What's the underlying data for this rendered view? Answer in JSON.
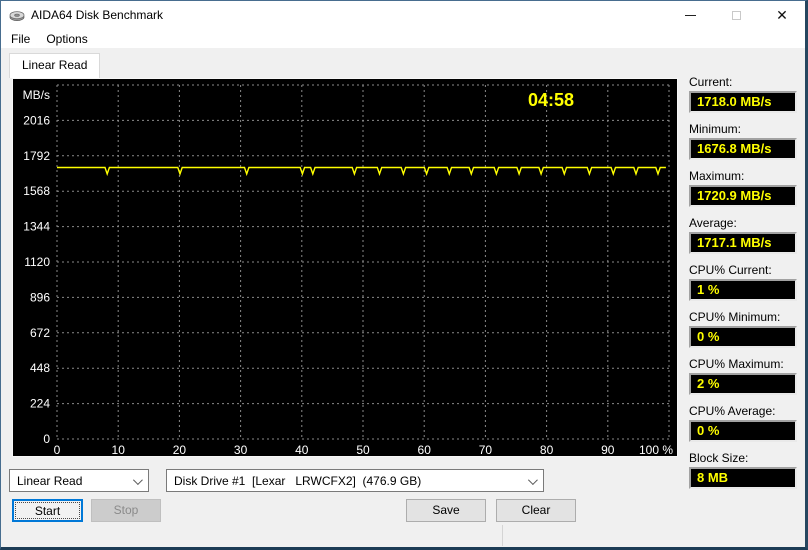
{
  "window": {
    "title": "AIDA64 Disk Benchmark"
  },
  "menu": {
    "items": [
      "File",
      "Options"
    ]
  },
  "tab": {
    "label": "Linear Read"
  },
  "chart_data": {
    "type": "line",
    "title": "",
    "time_label": "04:58",
    "ylabel": "MB/s",
    "xlabel": "",
    "ylim": [
      0,
      2240
    ],
    "yticks": [
      0,
      224,
      448,
      672,
      896,
      1120,
      1344,
      1568,
      1792,
      2016
    ],
    "xticks": [
      "0",
      "10",
      "20",
      "30",
      "40",
      "50",
      "60",
      "70",
      "80",
      "90",
      "100 %"
    ],
    "xlim_pct": [
      0,
      100
    ],
    "grid": true,
    "series": [
      {
        "name": "Linear Read MB/s",
        "baseline_value": 1718,
        "dip_value": 1677,
        "dip_positions_pct": [
          8.2,
          20.1,
          31.0,
          40.1,
          41.8,
          48.6,
          52.7,
          56.6,
          60.4,
          64.1,
          67.7,
          71.8,
          75.5,
          79.1,
          82.9,
          87.0,
          90.9,
          94.6,
          98.2
        ],
        "start_pct": 0,
        "end_pct": 99.5
      }
    ],
    "colors": {
      "background": "#000000",
      "grid": "#8a8a8a",
      "line": "#ffff00",
      "text": "#ffffff",
      "time": "#ffff00"
    }
  },
  "stats": [
    {
      "label": "Current:",
      "value": "1718.0 MB/s"
    },
    {
      "label": "Minimum:",
      "value": "1676.8 MB/s"
    },
    {
      "label": "Maximum:",
      "value": "1720.9 MB/s"
    },
    {
      "label": "Average:",
      "value": "1717.1 MB/s"
    },
    {
      "label": "CPU% Current:",
      "value": "1 %"
    },
    {
      "label": "CPU% Minimum:",
      "value": "0 %"
    },
    {
      "label": "CPU% Maximum:",
      "value": "2 %"
    },
    {
      "label": "CPU% Average:",
      "value": "0 %"
    },
    {
      "label": "Block Size:",
      "value": "8 MB"
    }
  ],
  "controls": {
    "benchmark_select_value": "Linear Read",
    "drive_select_value": "Disk Drive #1  [Lexar   LRWCFX2]  (476.9 GB)",
    "start_label": "Start",
    "stop_label": "Stop",
    "save_label": "Save",
    "clear_label": "Clear"
  },
  "colors": {
    "focus_blue": "#0078d7",
    "value_yellow": "#ffff00",
    "chart_bg": "#000000"
  }
}
